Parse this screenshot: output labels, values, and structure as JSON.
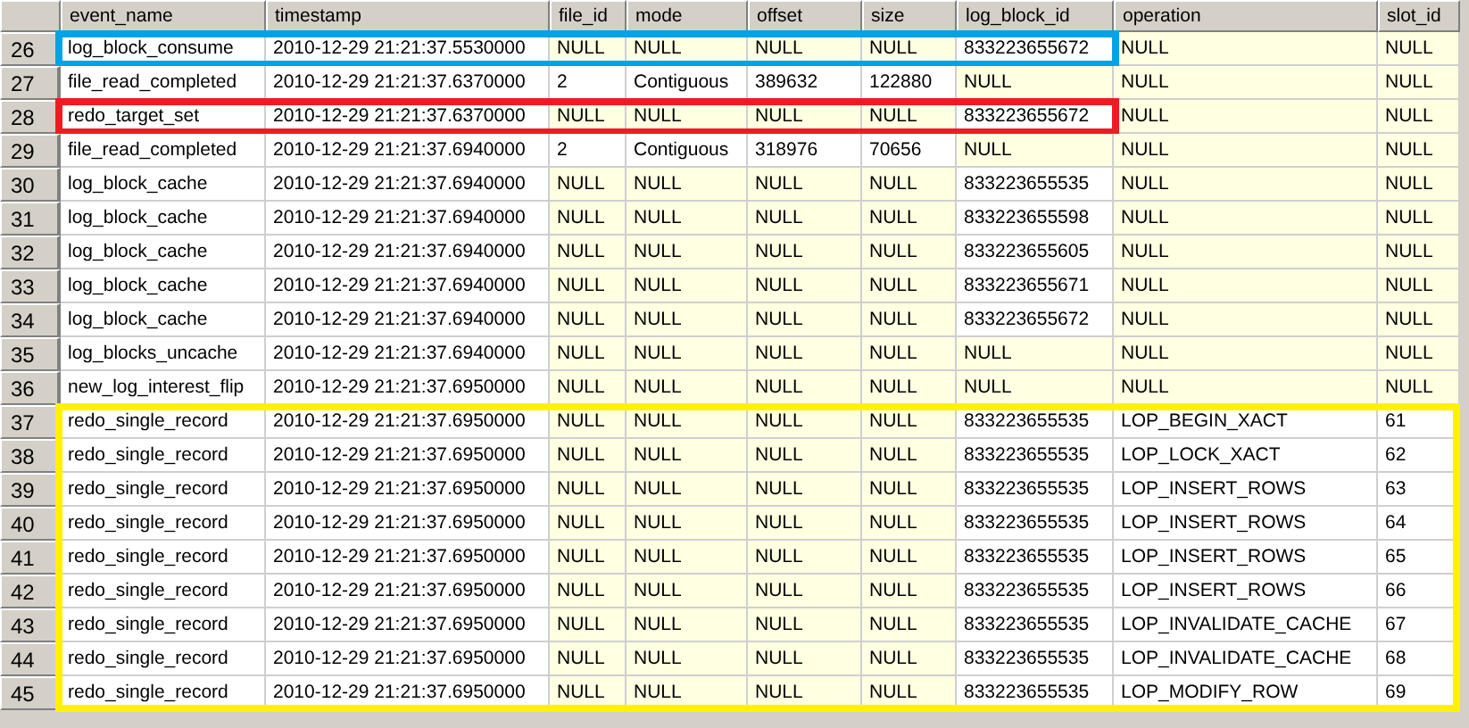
{
  "columns": [
    "event_name",
    "timestamp",
    "file_id",
    "mode",
    "offset",
    "size",
    "log_block_id",
    "operation",
    "slot_id"
  ],
  "row_groups": [
    {
      "kind": "box",
      "color": "#00a2e8",
      "rows": [
        {
          "number": "26",
          "cells": [
            "log_block_consume",
            "2010-12-29 21:21:37.5530000",
            "NULL",
            "NULL",
            "NULL",
            "NULL",
            "833223655672",
            "NULL",
            "NULL"
          ],
          "null": [
            false,
            false,
            true,
            true,
            true,
            true,
            false,
            true,
            true
          ]
        }
      ]
    },
    {
      "kind": "plain",
      "rows": [
        {
          "number": "27",
          "cells": [
            "file_read_completed",
            "2010-12-29 21:21:37.6370000",
            "2",
            "Contiguous",
            "389632",
            "122880",
            "NULL",
            "NULL",
            "NULL"
          ],
          "null": [
            false,
            false,
            false,
            false,
            false,
            false,
            true,
            true,
            true
          ]
        }
      ]
    },
    {
      "kind": "box",
      "color": "#ed1c24",
      "rows": [
        {
          "number": "28",
          "cells": [
            "redo_target_set",
            "2010-12-29 21:21:37.6370000",
            "NULL",
            "NULL",
            "NULL",
            "NULL",
            "833223655672",
            "NULL",
            "NULL"
          ],
          "null": [
            false,
            false,
            true,
            true,
            true,
            true,
            false,
            true,
            true
          ]
        }
      ]
    },
    {
      "kind": "plain",
      "rows": [
        {
          "number": "29",
          "cells": [
            "file_read_completed",
            "2010-12-29 21:21:37.6940000",
            "2",
            "Contiguous",
            "318976",
            "70656",
            "NULL",
            "NULL",
            "NULL"
          ],
          "null": [
            false,
            false,
            false,
            false,
            false,
            false,
            true,
            true,
            true
          ]
        },
        {
          "number": "30",
          "cells": [
            "log_block_cache",
            "2010-12-29 21:21:37.6940000",
            "NULL",
            "NULL",
            "NULL",
            "NULL",
            "833223655535",
            "NULL",
            "NULL"
          ],
          "null": [
            false,
            false,
            true,
            true,
            true,
            true,
            false,
            true,
            true
          ]
        },
        {
          "number": "31",
          "cells": [
            "log_block_cache",
            "2010-12-29 21:21:37.6940000",
            "NULL",
            "NULL",
            "NULL",
            "NULL",
            "833223655598",
            "NULL",
            "NULL"
          ],
          "null": [
            false,
            false,
            true,
            true,
            true,
            true,
            false,
            true,
            true
          ]
        },
        {
          "number": "32",
          "cells": [
            "log_block_cache",
            "2010-12-29 21:21:37.6940000",
            "NULL",
            "NULL",
            "NULL",
            "NULL",
            "833223655605",
            "NULL",
            "NULL"
          ],
          "null": [
            false,
            false,
            true,
            true,
            true,
            true,
            false,
            true,
            true
          ]
        },
        {
          "number": "33",
          "cells": [
            "log_block_cache",
            "2010-12-29 21:21:37.6940000",
            "NULL",
            "NULL",
            "NULL",
            "NULL",
            "833223655671",
            "NULL",
            "NULL"
          ],
          "null": [
            false,
            false,
            true,
            true,
            true,
            true,
            false,
            true,
            true
          ]
        },
        {
          "number": "34",
          "cells": [
            "log_block_cache",
            "2010-12-29 21:21:37.6940000",
            "NULL",
            "NULL",
            "NULL",
            "NULL",
            "833223655672",
            "NULL",
            "NULL"
          ],
          "null": [
            false,
            false,
            true,
            true,
            true,
            true,
            false,
            true,
            true
          ]
        },
        {
          "number": "35",
          "cells": [
            "log_blocks_uncache",
            "2010-12-29 21:21:37.6940000",
            "NULL",
            "NULL",
            "NULL",
            "NULL",
            "NULL",
            "NULL",
            "NULL"
          ],
          "null": [
            false,
            false,
            true,
            true,
            true,
            true,
            true,
            true,
            true
          ]
        },
        {
          "number": "36",
          "cells": [
            "new_log_interest_flip",
            "2010-12-29 21:21:37.6950000",
            "NULL",
            "NULL",
            "NULL",
            "NULL",
            "NULL",
            "NULL",
            "NULL"
          ],
          "null": [
            false,
            false,
            true,
            true,
            true,
            true,
            true,
            true,
            true
          ]
        }
      ]
    },
    {
      "kind": "band",
      "color": "#fff200",
      "rows": [
        {
          "number": "37",
          "cells": [
            "redo_single_record",
            "2010-12-29 21:21:37.6950000",
            "NULL",
            "NULL",
            "NULL",
            "NULL",
            "833223655535",
            "LOP_BEGIN_XACT",
            "61"
          ],
          "null": [
            false,
            false,
            true,
            true,
            true,
            true,
            false,
            false,
            false
          ]
        },
        {
          "number": "38",
          "cells": [
            "redo_single_record",
            "2010-12-29 21:21:37.6950000",
            "NULL",
            "NULL",
            "NULL",
            "NULL",
            "833223655535",
            "LOP_LOCK_XACT",
            "62"
          ],
          "null": [
            false,
            false,
            true,
            true,
            true,
            true,
            false,
            false,
            false
          ]
        },
        {
          "number": "39",
          "cells": [
            "redo_single_record",
            "2010-12-29 21:21:37.6950000",
            "NULL",
            "NULL",
            "NULL",
            "NULL",
            "833223655535",
            "LOP_INSERT_ROWS",
            "63"
          ],
          "null": [
            false,
            false,
            true,
            true,
            true,
            true,
            false,
            false,
            false
          ]
        },
        {
          "number": "40",
          "cells": [
            "redo_single_record",
            "2010-12-29 21:21:37.6950000",
            "NULL",
            "NULL",
            "NULL",
            "NULL",
            "833223655535",
            "LOP_INSERT_ROWS",
            "64"
          ],
          "null": [
            false,
            false,
            true,
            true,
            true,
            true,
            false,
            false,
            false
          ]
        },
        {
          "number": "41",
          "cells": [
            "redo_single_record",
            "2010-12-29 21:21:37.6950000",
            "NULL",
            "NULL",
            "NULL",
            "NULL",
            "833223655535",
            "LOP_INSERT_ROWS",
            "65"
          ],
          "null": [
            false,
            false,
            true,
            true,
            true,
            true,
            false,
            false,
            false
          ]
        },
        {
          "number": "42",
          "cells": [
            "redo_single_record",
            "2010-12-29 21:21:37.6950000",
            "NULL",
            "NULL",
            "NULL",
            "NULL",
            "833223655535",
            "LOP_INSERT_ROWS",
            "66"
          ],
          "null": [
            false,
            false,
            true,
            true,
            true,
            true,
            false,
            false,
            false
          ]
        },
        {
          "number": "43",
          "cells": [
            "redo_single_record",
            "2010-12-29 21:21:37.6950000",
            "NULL",
            "NULL",
            "NULL",
            "NULL",
            "833223655535",
            "LOP_INVALIDATE_CACHE",
            "67"
          ],
          "null": [
            false,
            false,
            true,
            true,
            true,
            true,
            false,
            false,
            false
          ]
        },
        {
          "number": "44",
          "cells": [
            "redo_single_record",
            "2010-12-29 21:21:37.6950000",
            "NULL",
            "NULL",
            "NULL",
            "NULL",
            "833223655535",
            "LOP_INVALIDATE_CACHE",
            "68"
          ],
          "null": [
            false,
            false,
            true,
            true,
            true,
            true,
            false,
            false,
            false
          ]
        },
        {
          "number": "45",
          "cells": [
            "redo_single_record",
            "2010-12-29 21:21:37.6950000",
            "NULL",
            "NULL",
            "NULL",
            "NULL",
            "833223655535",
            "LOP_MODIFY_ROW",
            "69"
          ],
          "null": [
            false,
            false,
            true,
            true,
            true,
            true,
            false,
            false,
            false
          ]
        }
      ]
    }
  ]
}
